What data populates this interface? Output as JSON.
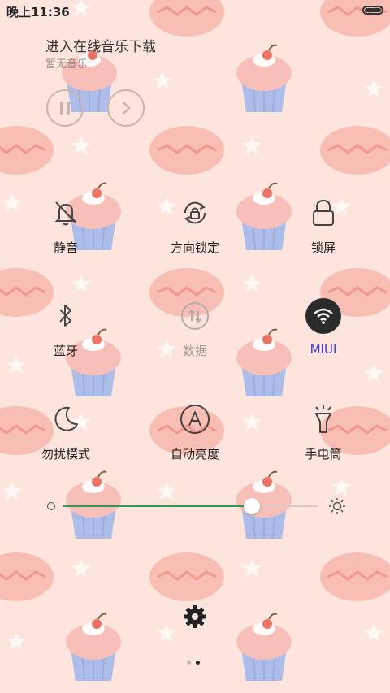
{
  "status_bar": {
    "time": "晚上11:36",
    "battery_level": 1.0
  },
  "music": {
    "title": "进入在线音乐下载",
    "subtitle": "暂无音乐"
  },
  "toggles": [
    {
      "label": "静音",
      "icon": "bell-off-icon",
      "state": "off"
    },
    {
      "label": "方向锁定",
      "icon": "rotation-lock-icon",
      "state": "off"
    },
    {
      "label": "锁屏",
      "icon": "lock-icon",
      "state": "off"
    },
    {
      "label": "蓝牙",
      "icon": "bluetooth-icon",
      "state": "off"
    },
    {
      "label": "数据",
      "icon": "mobile-data-icon",
      "state": "disabled"
    },
    {
      "label": "MIUI",
      "icon": "wifi-icon",
      "state": "on"
    },
    {
      "label": "勿扰模式",
      "icon": "moon-icon",
      "state": "off"
    },
    {
      "label": "自动亮度",
      "icon": "auto-brightness-icon",
      "state": "off"
    },
    {
      "label": "手电筒",
      "icon": "flashlight-icon",
      "state": "off"
    }
  ],
  "brightness": {
    "level": 0.74
  },
  "pager": {
    "total": 2,
    "current": 2
  },
  "colors": {
    "accent": "#3b3fe0",
    "slider_fill": "#2e9b5a",
    "wifi_active_bg": "#2b2b2b",
    "background": "#fde4dc"
  }
}
